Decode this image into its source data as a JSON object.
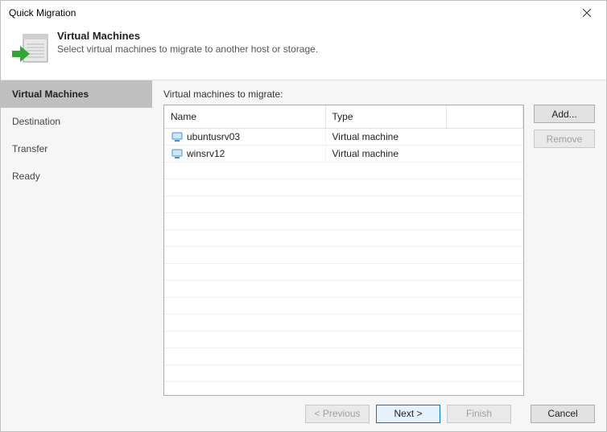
{
  "window": {
    "title": "Quick Migration"
  },
  "header": {
    "title": "Virtual Machines",
    "subtitle": "Select virtual machines to migrate to another host or storage."
  },
  "sidebar": {
    "steps": [
      {
        "label": "Virtual Machines",
        "active": true
      },
      {
        "label": "Destination",
        "active": false
      },
      {
        "label": "Transfer",
        "active": false
      },
      {
        "label": "Ready",
        "active": false
      }
    ]
  },
  "main": {
    "list_label": "Virtual machines to migrate:",
    "columns": {
      "c0": "Name",
      "c1": "Type",
      "c2": ""
    },
    "rows": [
      {
        "name": "ubuntusrv03",
        "type": "Virtual machine"
      },
      {
        "name": "winsrv12",
        "type": "Virtual machine"
      }
    ],
    "buttons": {
      "add": "Add...",
      "remove": "Remove"
    }
  },
  "footer": {
    "previous": "< Previous",
    "next": "Next >",
    "finish": "Finish",
    "cancel": "Cancel"
  }
}
